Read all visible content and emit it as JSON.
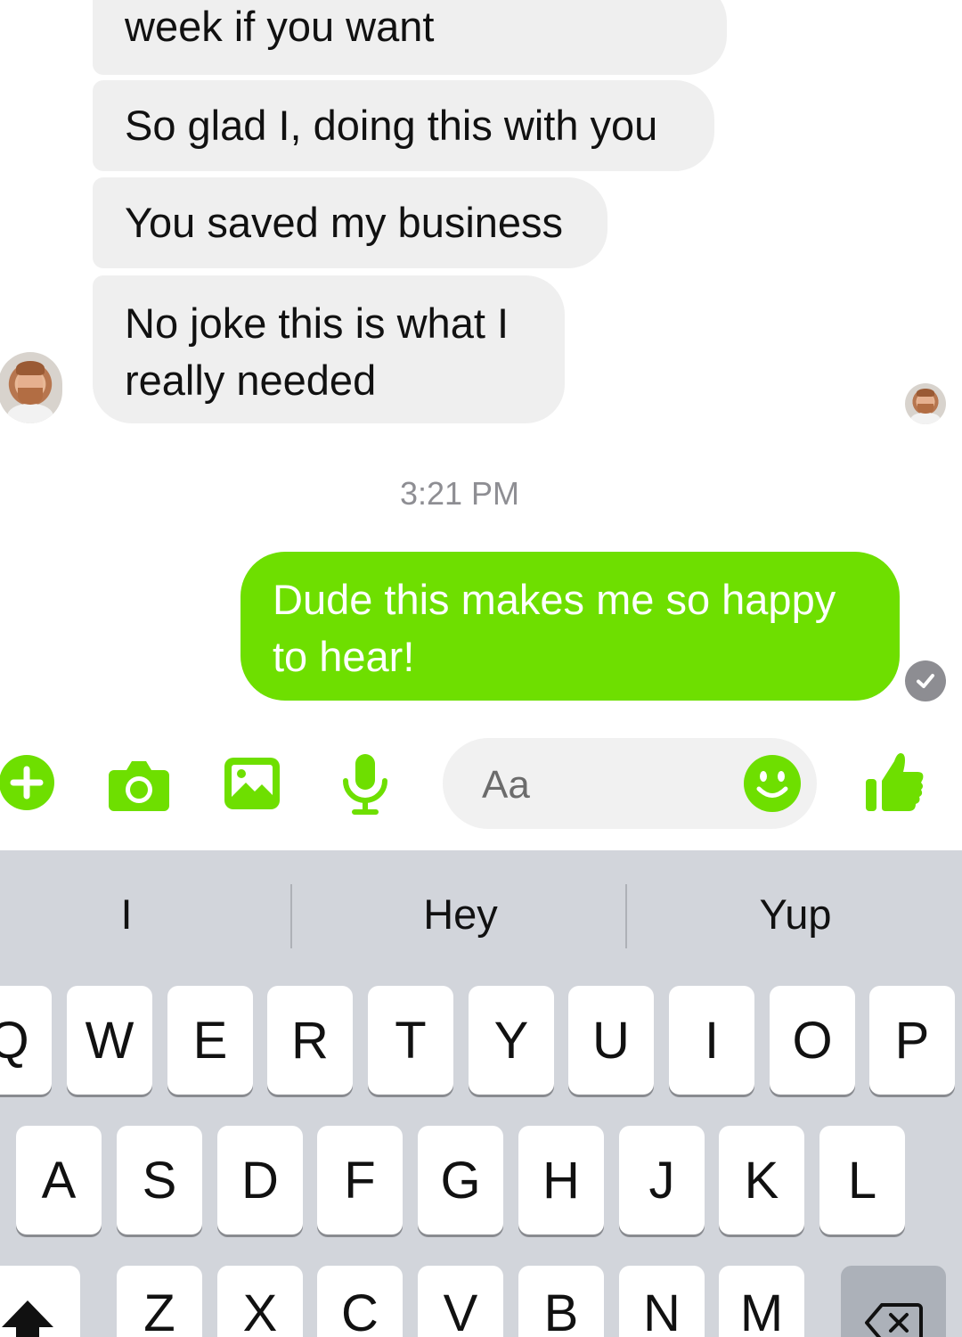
{
  "conversation": {
    "incoming": [
      "week if you want",
      "So glad I, doing this with you",
      "You saved my business",
      "No joke this is what I really needed"
    ],
    "timestamp": "3:21 PM",
    "outgoing": [
      "Dude this makes me so happy to hear!"
    ],
    "outgoing_status": "check-icon"
  },
  "composer": {
    "placeholder": "Aa",
    "icons": [
      "plus-icon",
      "camera-icon",
      "image-icon",
      "microphone-icon",
      "emoji-icon",
      "thumbs-up-icon"
    ],
    "accent_color": "#6edf00"
  },
  "keyboard": {
    "suggestions": [
      "I",
      "Hey",
      "Yup"
    ],
    "row1": [
      "Q",
      "W",
      "E",
      "R",
      "T",
      "Y",
      "U",
      "I",
      "O",
      "P"
    ],
    "row2": [
      "A",
      "S",
      "D",
      "F",
      "G",
      "H",
      "J",
      "K",
      "L"
    ],
    "row3": [
      "Z",
      "X",
      "C",
      "V",
      "B",
      "N",
      "M"
    ],
    "shift_icon": "shift-icon",
    "backspace_icon": "backspace-icon"
  }
}
